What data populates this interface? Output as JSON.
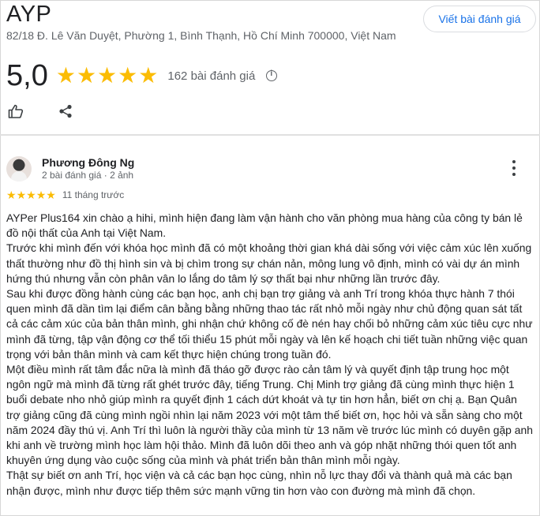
{
  "business": {
    "name": "AYP",
    "address": "82/18 Đ. Lê Văn Duyệt, Phường 1, Bình Thạnh, Hồ Chí Minh 700000, Việt Nam",
    "write_review_label": "Viết bài đánh giá",
    "rating": "5,0",
    "stars": 5,
    "review_count": "162 bài đánh giá"
  },
  "colors": {
    "star": "#fbbc04",
    "accent": "#1a73e8"
  },
  "icons": [
    "info-icon",
    "like-icon",
    "share-icon",
    "more-vertical-icon",
    "avatar"
  ],
  "review": {
    "author": "Phương Đông Ng",
    "meta": "2 bài đánh giá · 2 ảnh",
    "stars": 5,
    "time": "11 tháng trước",
    "paragraphs": [
      "AYPer Plus164 xin chào ạ hihi, mình hiện đang làm vận hành cho văn phòng mua hàng của công ty bán lẻ đồ nội thất của Anh tại Việt Nam.",
      "Trước khi mình đến với khóa học mình đã có một khoảng thời gian khá dài sống với việc cảm xúc lên xuống thất thường như đồ thị hình sin và bị chìm trong sự chán nản, mông lung vô định, mình có vài dự án mình hứng thú nhưng vẫn còn phân vân lo lắng do tâm lý sợ thất bại như những lần trước đây.",
      "Sau khi được đồng hành cùng các bạn học, anh chị bạn trợ giảng và anh Trí trong khóa thực hành 7 thói quen mình đã dần tìm lại điểm cân bằng bằng những thao tác rất nhỏ mỗi ngày như chủ động quan sát tất cả các cảm xúc của bản thân mình, ghi nhận chứ không cố đè nén hay chối bỏ những cảm xúc tiêu cực như mình đã từng, tập vận động cơ thể tối thiểu 15 phút mỗi ngày và lên kế hoạch chi tiết tuần những việc quan trọng với bản thân mình và cam kết thực hiện chúng trong tuần đó.",
      "Một điều mình rất tâm đắc nữa là mình đã tháo gỡ được rào cản tâm lý và quyết định tập trung học một ngôn ngữ mà mình đã từng rất ghét trước đây, tiếng Trung. Chị Minh trợ giảng đã cùng mình thực hiện 1 buổi debate nho nhỏ giúp mình ra quyết định 1 cách dứt khoát và tự tin hơn hẳn, biết ơn chị ạ. Bạn Quân trợ giảng cũng đã cùng mình ngồi nhìn lại năm 2023 với một tâm thế biết ơn, học hỏi và sẵn sàng cho một năm 2024 đầy thú vị. Anh Trí thì luôn là người thầy của mình từ 13 năm về trước lúc mình có duyên gặp anh khi anh về trường mình học làm hội thảo. Mình đã luôn dõi theo anh và góp nhặt những thói quen tốt anh khuyên ứng dụng vào cuộc sống của mình và phát triển bản thân mình mỗi ngày.",
      "Thật sự biết ơn anh Trí, học viện và cả các bạn học cùng, nhìn nỗ lực thay đổi và thành quả mà các bạn nhận được, mình như được tiếp thêm sức mạnh vững tin hơn vào con đường mà mình đã chọn."
    ]
  }
}
